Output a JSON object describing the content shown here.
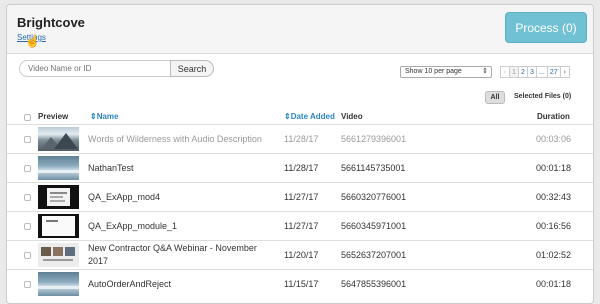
{
  "header": {
    "title": "Brightcove",
    "settings_label": "Settings",
    "process_label": "Process (0)"
  },
  "search": {
    "placeholder": "Video Name or ID",
    "button_label": "Search"
  },
  "per_page": {
    "selected": "Show 10 per page"
  },
  "pagination": {
    "prev": "‹",
    "pages": [
      "1",
      "2",
      "3",
      "...",
      "27"
    ],
    "next": "›"
  },
  "filters": {
    "all_label": "All",
    "selected_label": "Selected Files (0)"
  },
  "columns": {
    "preview": "Preview",
    "name": "Name",
    "date_added": "Date Added",
    "video": "Video",
    "duration": "Duration",
    "sort_icon": "⇕"
  },
  "rows": [
    {
      "name": "Words of Wilderness with Audio Description",
      "date": "11/28/17",
      "video": "5661279396001",
      "duration": "00:03:06",
      "thumb": "mountain"
    },
    {
      "name": "NathanTest",
      "date": "11/28/17",
      "video": "5661145735001",
      "duration": "00:01:18",
      "thumb": "water"
    },
    {
      "name": "QA_ExApp_mod4",
      "date": "11/27/17",
      "video": "5660320776001",
      "duration": "00:32:43",
      "thumb": "slide-dark"
    },
    {
      "name": "QA_ExApp_module_1",
      "date": "11/27/17",
      "video": "5660345971001",
      "duration": "00:16:56",
      "thumb": "slide-white"
    },
    {
      "name": "New Contractor Q&A Webinar - November",
      "name2": "2017",
      "date": "11/20/17",
      "video": "5652637207001",
      "duration": "01:02:52",
      "thumb": "webinar"
    },
    {
      "name": "AutoOrderAndReject",
      "date": "11/15/17",
      "video": "5647855396001",
      "duration": "00:01:18",
      "thumb": "water"
    }
  ]
}
